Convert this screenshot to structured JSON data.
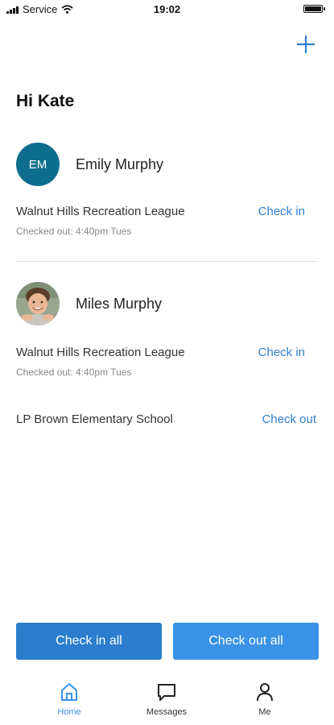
{
  "status_bar": {
    "carrier": "Service",
    "time": "19:02"
  },
  "header": {
    "add_icon": "plus-icon",
    "greeting": "Hi Kate"
  },
  "children": [
    {
      "initials": "EM",
      "name": "Emily Murphy",
      "avatar_color": "#0f6e8d",
      "activities": [
        {
          "title": "Walnut Hills Recreation League",
          "status": "Checked out: 4:40pm Tues",
          "action": "Check in"
        }
      ]
    },
    {
      "name": "Miles Murphy",
      "activities": [
        {
          "title": "Walnut Hills Recreation League",
          "status": "Checked out: 4:40pm Tues",
          "action": "Check in"
        },
        {
          "title": "LP Brown Elementary School",
          "action": "Check out"
        }
      ]
    }
  ],
  "actions": {
    "check_in_all": "Check in all",
    "check_out_all": "Check out all"
  },
  "tabs": [
    {
      "label": "Home",
      "icon": "home-icon",
      "active": true
    },
    {
      "label": "Messages",
      "icon": "message-icon",
      "active": false
    },
    {
      "label": "Me",
      "icon": "person-icon",
      "active": false
    }
  ],
  "colors": {
    "accent": "#2f7fd0",
    "button_primary": "#2c7dcd",
    "button_secondary": "#3a93e6"
  }
}
